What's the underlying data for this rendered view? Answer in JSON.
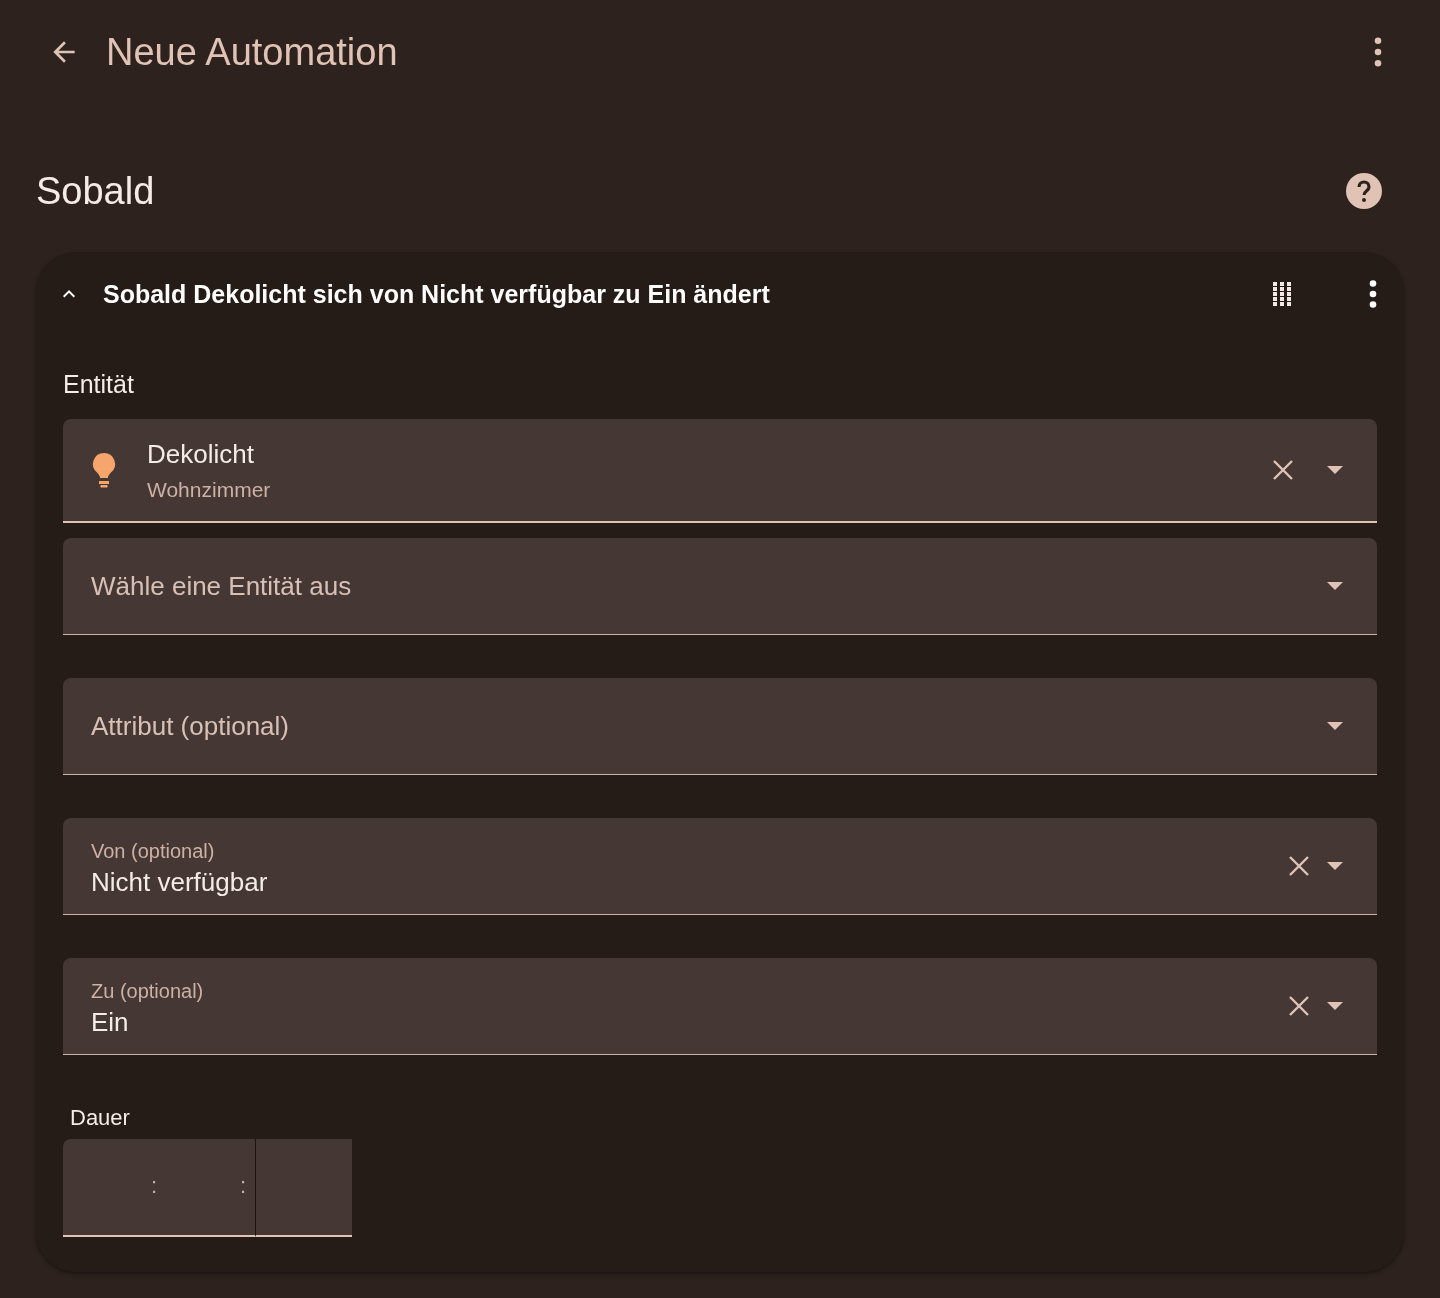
{
  "header": {
    "title": "Neue Automation"
  },
  "section": {
    "title": "Sobald"
  },
  "trigger": {
    "title": "Sobald Dekolicht sich von Nicht verfügbar zu Ein ändert",
    "expanded": true,
    "entity_label": "Entität",
    "fields": [
      {
        "kind": "entity",
        "name": "Dekolicht",
        "area": "Wohnzimmer",
        "clearable": true
      },
      {
        "kind": "select",
        "placeholder": "Wähle eine Entität aus",
        "clearable": false
      },
      {
        "kind": "select",
        "placeholder": "Attribut (optional)",
        "clearable": false
      },
      {
        "kind": "select",
        "label": "Von (optional)",
        "value": "Nicht verfügbar",
        "clearable": true
      },
      {
        "kind": "select",
        "label": "Zu (optional)",
        "value": "Ein",
        "clearable": true
      }
    ],
    "duration": {
      "label": "Dauer",
      "separators": [
        ":",
        ":"
      ]
    }
  }
}
